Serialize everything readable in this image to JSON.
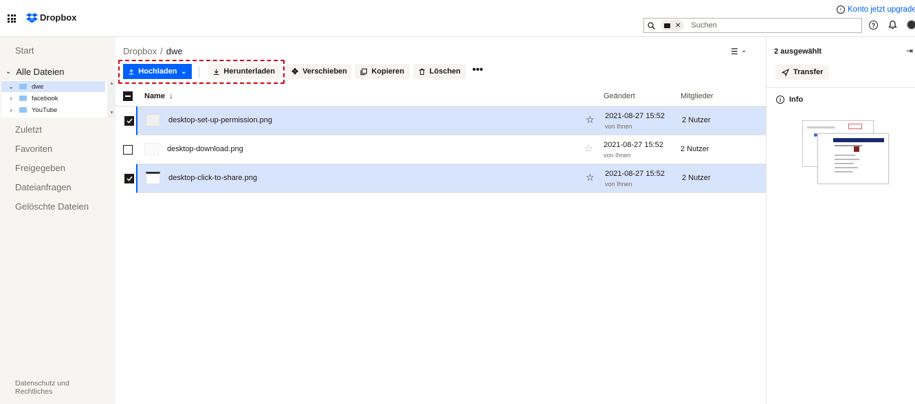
{
  "brand": {
    "name": "Dropbox"
  },
  "header": {
    "upgrade_label": "Konto jetzt upgrader",
    "search_placeholder": "Suchen",
    "search_chip_close": "✕"
  },
  "sidebar": {
    "start": "Start",
    "all_files": "Alle Dateien",
    "tree": [
      {
        "label": "dwe",
        "selected": true,
        "expanded": true
      },
      {
        "label": "facebook",
        "selected": false,
        "expanded": false
      },
      {
        "label": "YouTube",
        "selected": false,
        "expanded": false
      }
    ],
    "links": [
      "Zuletzt",
      "Favoriten",
      "Freigegeben",
      "Dateianfragen",
      "Gelöschte Dateien"
    ],
    "footer": "Datenschutz und Rechtliches"
  },
  "main": {
    "breadcrumb_root": "Dropbox",
    "breadcrumb_sep": "/",
    "breadcrumb_current": "dwe",
    "toolbar": {
      "upload": "Hochladen",
      "download": "Herunterladen",
      "move": "Verschieben",
      "copy": "Kopieren",
      "delete": "Löschen",
      "more": "•••"
    },
    "columns": {
      "name": "Name",
      "modified": "Geändert",
      "members": "Mitglieder"
    },
    "files": [
      {
        "name": "desktop-set-up-permission.png",
        "modified": "2021-08-27 15:52",
        "by": "von Ihnen",
        "members": "2 Nutzer",
        "selected": true
      },
      {
        "name": "desktop-download.png",
        "modified": "2021-08-27 15:52",
        "by": "von Ihnen",
        "members": "2 Nutzer",
        "selected": false
      },
      {
        "name": "desktop-click-to-share.png",
        "modified": "2021-08-27 15:52",
        "by": "von Ihnen",
        "members": "2 Nutzer",
        "selected": true
      }
    ]
  },
  "panel": {
    "selected_count": "2 ausgewählt",
    "transfer": "Transfer",
    "info": "Info"
  },
  "colors": {
    "accent": "#0061fe",
    "selected_row": "#d7e4fb",
    "highlight": "#d40000"
  }
}
